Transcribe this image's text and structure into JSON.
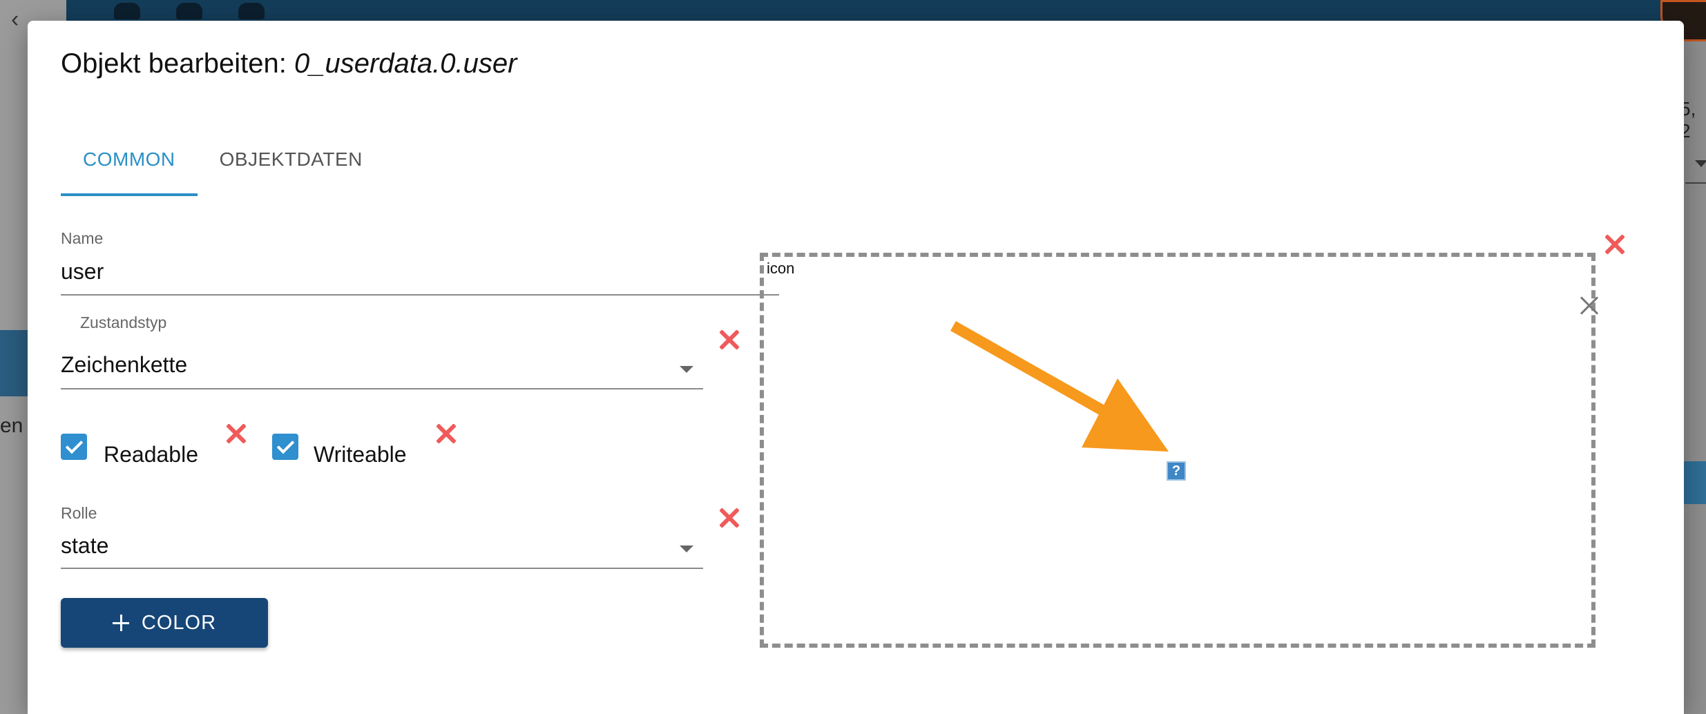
{
  "background": {
    "text_left": "en",
    "text_right": "5, 2"
  },
  "dialog": {
    "title_prefix": "Objekt bearbeiten: ",
    "title_object": "0_userdata.0.user"
  },
  "tabs": [
    {
      "label": "COMMON",
      "active": true
    },
    {
      "label": "OBJEKTDATEN",
      "active": false
    }
  ],
  "form": {
    "name": {
      "label": "Name",
      "value": "user"
    },
    "state_type": {
      "label": "Zustandstyp",
      "value": "Zeichenkette"
    },
    "readable": {
      "label": "Readable",
      "checked": true
    },
    "writeable": {
      "label": "Writeable",
      "checked": true
    },
    "role": {
      "label": "Rolle",
      "value": "state"
    },
    "color_button": {
      "label": "COLOR"
    }
  },
  "icon_dropzone": {
    "label": "icon",
    "placeholder_glyph": "?"
  },
  "colors": {
    "accent": "#2b8fc6",
    "primary_button": "#164677",
    "delete": "#ef5a5a",
    "checkbox": "#2f8fcf",
    "annotation_arrow": "#f7991c"
  }
}
